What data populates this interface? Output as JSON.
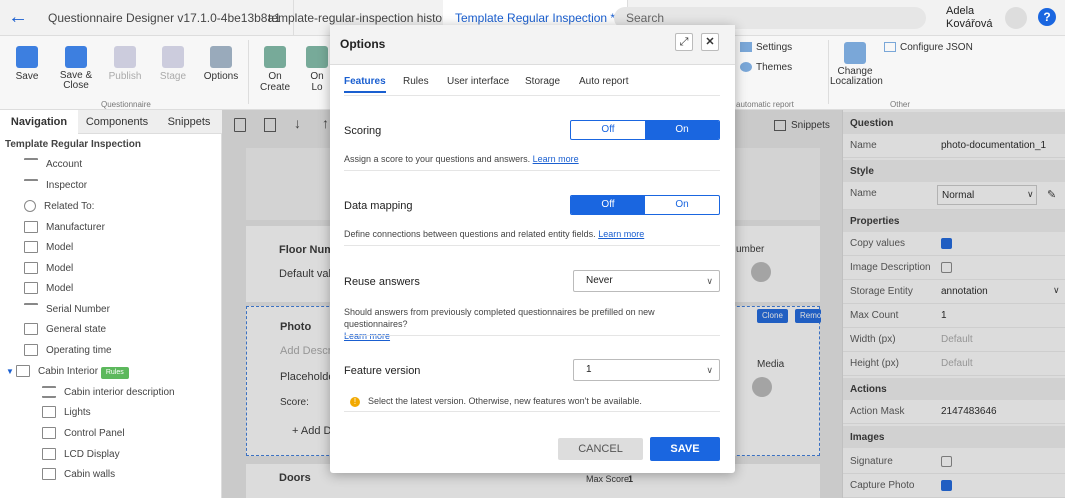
{
  "topbar": {
    "tabs": [
      "Questionnaire Designer v17.1.0-4be13b8a1",
      "template-regular-inspection history",
      "Template Regular Inspection *"
    ],
    "search_placeholder": "Search",
    "user_first": "Adela",
    "user_last": "Kovářová"
  },
  "ribbon": {
    "buttons": [
      "Save",
      "Save &",
      "Close",
      "Publish",
      "Stage",
      "Options",
      "On Create",
      "On Lo"
    ],
    "group1": "Questionnaire",
    "settings": "Settings",
    "themes": "Themes",
    "auto_report": "automatic report",
    "change": "Change",
    "localization": "Localization",
    "configure_json": "Configure JSON",
    "other": "Other"
  },
  "left": {
    "tabs": [
      "Navigation",
      "Components",
      "Snippets"
    ],
    "root": "Template Regular Inspection",
    "items": [
      "Account",
      "Inspector",
      "Related To:",
      "Manufacturer",
      "Model",
      "Model",
      "Model",
      "Serial Number",
      "General state",
      "Operating time",
      "Cabin Interior",
      "Cabin interior description",
      "Lights",
      "Control Panel",
      "LCD Display",
      "Cabin walls"
    ],
    "rules_badge": "Rules"
  },
  "middle": {
    "snippets": "Snippets",
    "floor": "Floor Num",
    "default_val": "Default valu",
    "photo": "Photo",
    "add_desc": "Add Descri",
    "placeholder": "Placeholde",
    "score": "Score:",
    "add_d": "+ Add D",
    "doors": "Doors",
    "max_score_label": "Max Score:",
    "max_score": "1",
    "clone": "Clone",
    "remove": "Remove",
    "number_frag": "umber",
    "media_frag": "Media"
  },
  "right": {
    "question": "Question",
    "name_k": "Name",
    "name_v": "photo-documentation_1",
    "style": "Style",
    "style_name_k": "Name",
    "style_name_v": "Normal",
    "properties": "Properties",
    "copy_values": "Copy values",
    "image_desc": "Image Description",
    "storage_entity_k": "Storage Entity",
    "storage_entity_v": "annotation",
    "max_count_k": "Max Count",
    "max_count_v": "1",
    "width_k": "Width (px)",
    "width_v": "Default",
    "height_k": "Height (px)",
    "height_v": "Default",
    "actions": "Actions",
    "action_mask_k": "Action Mask",
    "action_mask_v": "2147483646",
    "images": "Images",
    "signature": "Signature",
    "capture_photo": "Capture Photo"
  },
  "dialog": {
    "title": "Options",
    "tabs": [
      "Features",
      "Rules",
      "User interface",
      "Storage",
      "Auto report"
    ],
    "scoring": {
      "label": "Scoring",
      "off": "Off",
      "on": "On",
      "selected": "On",
      "desc": "Assign a score to your questions and answers.",
      "link": "Learn more"
    },
    "data_mapping": {
      "label": "Data mapping",
      "off": "Off",
      "on": "On",
      "selected": "Off",
      "desc": "Define connections between questions and related entity fields.",
      "link": "Learn more"
    },
    "reuse": {
      "label": "Reuse answers",
      "value": "Never",
      "desc": "Should answers from previously completed questionnaires be prefilled on new questionnaires?",
      "link": "Learn more"
    },
    "feature_version": {
      "label": "Feature version",
      "value": "1",
      "warning": "Select the latest version. Otherwise, new features won't be available."
    },
    "cancel": "CANCEL",
    "save": "SAVE"
  },
  "colors": {
    "accent": "#1a66e0"
  }
}
